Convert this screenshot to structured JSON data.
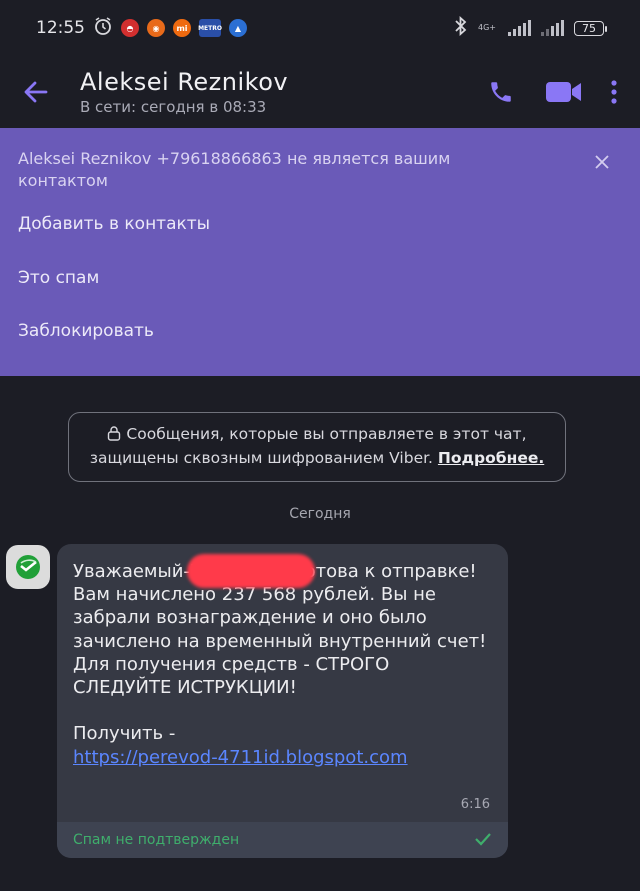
{
  "statusbar": {
    "time": "12:55",
    "network": "4G+",
    "battery": "75"
  },
  "header": {
    "contact_name": "Aleksei Reznikov",
    "contact_status": "В сети: сегодня в 08:33"
  },
  "banner": {
    "text": "Aleksei Reznikov +79618866863 не является вашим контактом",
    "actions": [
      "Добавить в контакты",
      "Это спам",
      "Заблокировать"
    ]
  },
  "notice": {
    "text": "Сообщения, которые вы отправляете в этот чат, защищены сквозным шифрованием Viber.",
    "link": "Подробнее."
  },
  "date_separator": "Сегодня",
  "message": {
    "text_part1": "Уважаемый-7                       Выплата готова к отправке!\nВам начислено 237 568 рублей. Вы не забрали вознаграждение и оно было зачислено на временный внутренний счет! Для получения средств - СТРОГО СЛЕДУЙТЕ ИСТРУКЦИИ!\n\nПолучить -",
    "link": "https://perevod-4711id.blogspot.com",
    "time": "6:16",
    "spam_status": "Спам не подтвержден"
  },
  "colors": {
    "accent": "#7360f2",
    "banner": "#6a5ab8",
    "background": "#1c1d25",
    "bubble": "#363944",
    "spam_green": "#3fae6c",
    "link": "#5b86ff"
  }
}
